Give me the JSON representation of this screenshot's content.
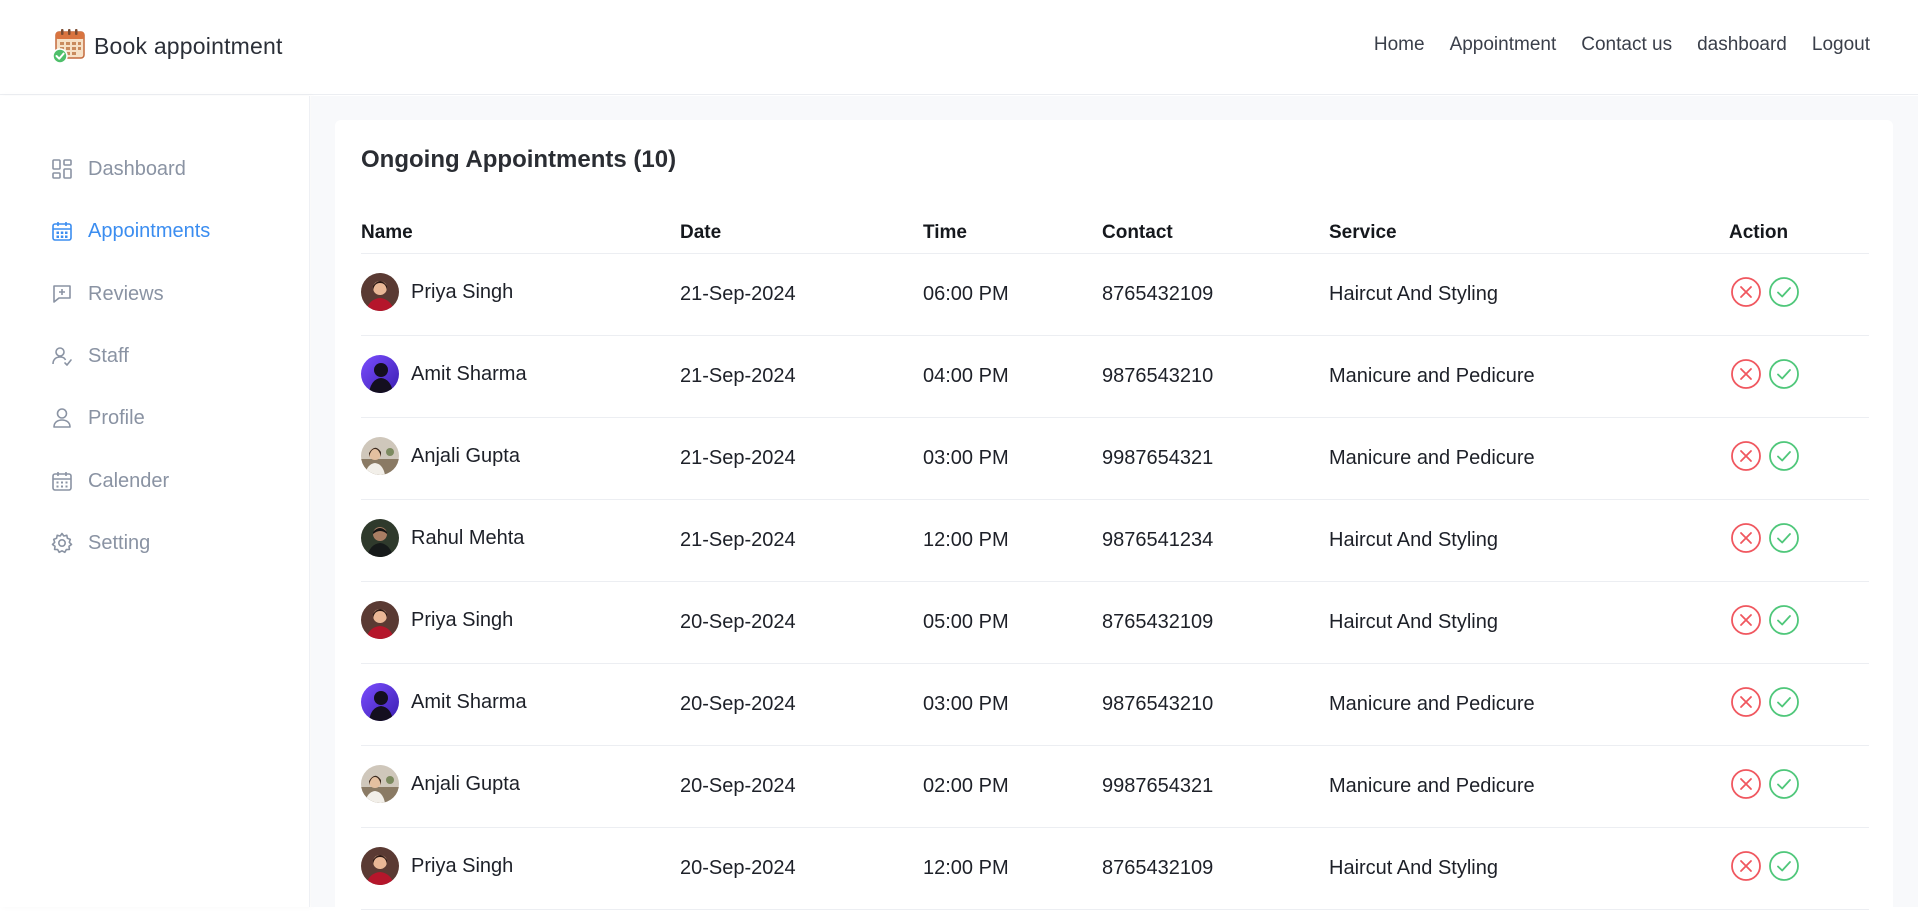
{
  "header": {
    "brand": "Book appointment",
    "nav": [
      "Home",
      "Appointment",
      "Contact us",
      "dashboard",
      "Logout"
    ]
  },
  "sidebar": {
    "items": [
      {
        "label": "Dashboard",
        "icon": "dashboard-icon"
      },
      {
        "label": "Appointments",
        "icon": "calendar-icon",
        "active": true
      },
      {
        "label": "Reviews",
        "icon": "review-icon"
      },
      {
        "label": "Staff",
        "icon": "staff-icon"
      },
      {
        "label": "Profile",
        "icon": "user-icon"
      },
      {
        "label": "Calender",
        "icon": "calendar-grid-icon"
      },
      {
        "label": "Setting",
        "icon": "gear-icon"
      }
    ]
  },
  "main": {
    "title": "Ongoing Appointments (10)",
    "columns": [
      "Name",
      "Date",
      "Time",
      "Contact",
      "Service",
      "Action"
    ],
    "rows": [
      {
        "name": "Priya Singh",
        "date": "21-Sep-2024",
        "time": "06:00 PM",
        "contact": "8765432109",
        "service": "Haircut And Styling",
        "avatar": "priya"
      },
      {
        "name": "Amit Sharma",
        "date": "21-Sep-2024",
        "time": "04:00 PM",
        "contact": "9876543210",
        "service": "Manicure and Pedicure",
        "avatar": "amit"
      },
      {
        "name": "Anjali Gupta",
        "date": "21-Sep-2024",
        "time": "03:00 PM",
        "contact": "9987654321",
        "service": "Manicure and Pedicure",
        "avatar": "anjali"
      },
      {
        "name": "Rahul Mehta",
        "date": "21-Sep-2024",
        "time": "12:00 PM",
        "contact": "9876541234",
        "service": "Haircut And Styling",
        "avatar": "rahul"
      },
      {
        "name": "Priya Singh",
        "date": "20-Sep-2024",
        "time": "05:00 PM",
        "contact": "8765432109",
        "service": "Haircut And Styling",
        "avatar": "priya"
      },
      {
        "name": "Amit Sharma",
        "date": "20-Sep-2024",
        "time": "03:00 PM",
        "contact": "9876543210",
        "service": "Manicure and Pedicure",
        "avatar": "amit"
      },
      {
        "name": "Anjali Gupta",
        "date": "20-Sep-2024",
        "time": "02:00 PM",
        "contact": "9987654321",
        "service": "Manicure and Pedicure",
        "avatar": "anjali"
      },
      {
        "name": "Priya Singh",
        "date": "20-Sep-2024",
        "time": "12:00 PM",
        "contact": "8765432109",
        "service": "Haircut And Styling",
        "avatar": "priya"
      }
    ]
  },
  "colors": {
    "accent": "#3b8df0",
    "reject": "#f0575f",
    "accept": "#4fc77a",
    "sidebar_text": "#8a93a3"
  }
}
